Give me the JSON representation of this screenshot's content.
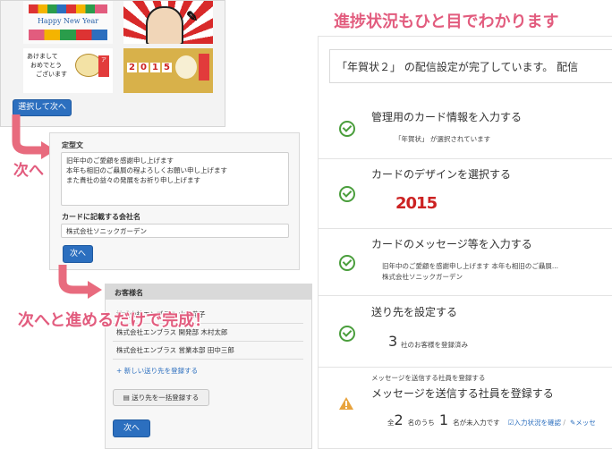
{
  "headline": "進捗状況もひと目でわかります",
  "panel1": {
    "card1_text": "Happy New Year",
    "card3_text": [
      "あけまして",
      "おめでとう",
      "ございます"
    ],
    "card4_year": [
      "2",
      "0",
      "1",
      "5"
    ],
    "next_button": "選択して次へ"
  },
  "callout1": "次へ",
  "callout2": "次へと進めるだけで完成！",
  "panel2": {
    "fixed_text_label": "定型文",
    "fixed_text_value": [
      "旧年中のご愛顧を感謝申し上げます",
      "本年も相旧のご贔屓の程よろしくお願い申し上げます",
      "また貴社の益々の発展をお祈り申し上げます"
    ],
    "company_label": "カードに記載する会社名",
    "company_value": "株式会社ソニックガーデン",
    "next_button": "次へ"
  },
  "panel3": {
    "header": "お客様名",
    "rows": [
      "株式会社エンブラス 山田花子",
      "株式会社エンブラス 開発部 木村太郎",
      "株式会社エンブラス 営業本部 田中三郎"
    ],
    "add_link": "新しい送り先を登録する",
    "bulk_button": "送り先を一括登録する",
    "next_button": "次へ"
  },
  "right_panel": {
    "status_message": "「年賀状２」 の配信設定が完了しています。 配信",
    "steps": [
      {
        "title": "管理用のカード情報を入力する",
        "sub": "「年賀状」 が選択されています",
        "status": "done"
      },
      {
        "title": "カードのデザインを選択する",
        "sub": "2015",
        "status": "done"
      },
      {
        "title": "カードのメッセージ等を入力する",
        "sub": [
          "旧年中のご愛顧を感謝申し上げます 本年も相旧のご贔屓...",
          "株式会社ソニックガーデン"
        ],
        "status": "done"
      },
      {
        "title": "送り先を設定する",
        "count": "3",
        "sub": "社のお客様を登録済み",
        "status": "done"
      },
      {
        "title": "メッセージを送信する社員を登録する",
        "small_title": "メッセージを送信する社員を登録する",
        "total_prefix": "全",
        "total": "2",
        "total_suffix": "名のうち",
        "pending": "1",
        "pending_suffix": "名が未入力です",
        "link1": "入力状況を確認",
        "link2": "メッセ",
        "status": "warning"
      }
    ]
  },
  "colors": {
    "accent_pink": "#e25c7e",
    "primary_blue": "#2c6fbf",
    "check_green": "#4a9e3c",
    "warning_orange": "#e8a33d"
  }
}
